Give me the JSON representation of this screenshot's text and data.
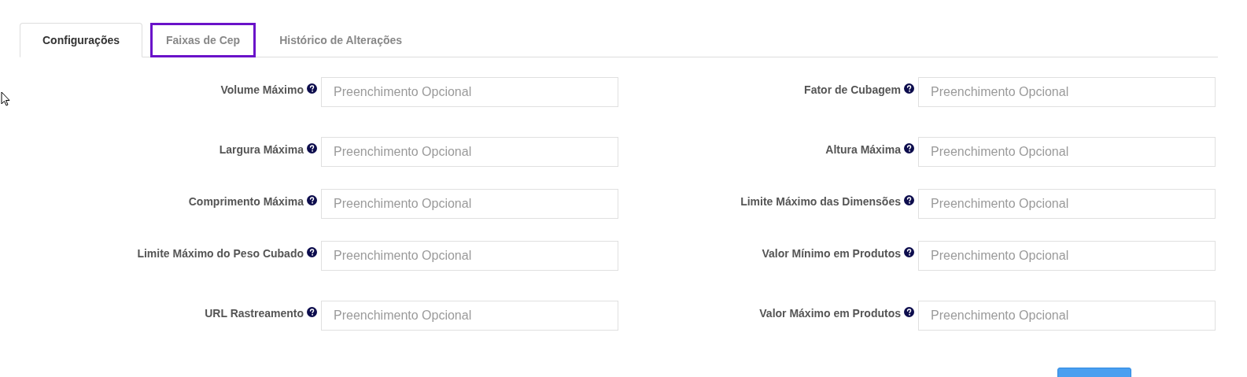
{
  "tabs": [
    {
      "label": "Configurações",
      "selected": true,
      "focused": false
    },
    {
      "label": "Faixas de Cep",
      "selected": false,
      "focused": true
    },
    {
      "label": "Histórico de Alterações",
      "selected": false,
      "focused": false
    }
  ],
  "rows": [
    {
      "fields": [
        {
          "label": "Volume Máximo",
          "placeholder": "Preenchimento Opcional"
        },
        {
          "label": "Fator de Cubagem",
          "placeholder": "Preenchimento Opcional"
        }
      ]
    },
    {
      "fields": [
        {
          "label": "Largura Máxima",
          "placeholder": "Preenchimento Opcional"
        },
        {
          "label": "Altura Máxima",
          "placeholder": "Preenchimento Opcional"
        }
      ]
    },
    {
      "fields": [
        {
          "label": "Comprimento Máxima",
          "placeholder": "Preenchimento Opcional"
        },
        {
          "label": "Limite Máximo das Dimensões",
          "placeholder": "Preenchimento Opcional"
        }
      ]
    },
    {
      "fields": [
        {
          "label": "Limite Máximo do Peso Cubado",
          "placeholder": "Preenchimento Opcional"
        },
        {
          "label": "Valor Mínimo em Produtos",
          "placeholder": "Preenchimento Opcional"
        }
      ]
    },
    {
      "fields": [
        {
          "label": "URL Rastreamento",
          "placeholder": "Preenchimento Opcional"
        },
        {
          "label": "Valor Máximo em Produtos",
          "placeholder": "Preenchimento Opcional"
        }
      ]
    }
  ]
}
